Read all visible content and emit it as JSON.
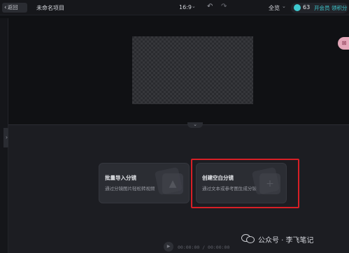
{
  "topbar": {
    "back_label": "返回",
    "project_name": "未命名项目",
    "aspect_ratio": "16:9",
    "overview_label": "全览",
    "credits": "63",
    "vip_link": "开会员 领积分"
  },
  "storyboard": {
    "cards": [
      {
        "title": "批量导入分镜",
        "desc": "通过分镜图片轻松转视频"
      },
      {
        "title": "创建空白分镜",
        "desc": "通过文本或参考图生成分镜"
      }
    ]
  },
  "playback": {
    "timecode": "00:00:00 / 00:00:00"
  },
  "watermark": {
    "text": "公众号 · 李飞笔记"
  },
  "colors": {
    "accent": "#3ec9cf",
    "highlight": "#d81f26",
    "background": "#101114"
  },
  "icons": [
    "chevron-left-icon",
    "caret-down-icon",
    "undo-icon",
    "redo-icon",
    "credit-coin-icon",
    "play-icon",
    "chevron-right-icon",
    "chevron-down-icon",
    "image-card-icon",
    "wechat-logo-icon"
  ]
}
